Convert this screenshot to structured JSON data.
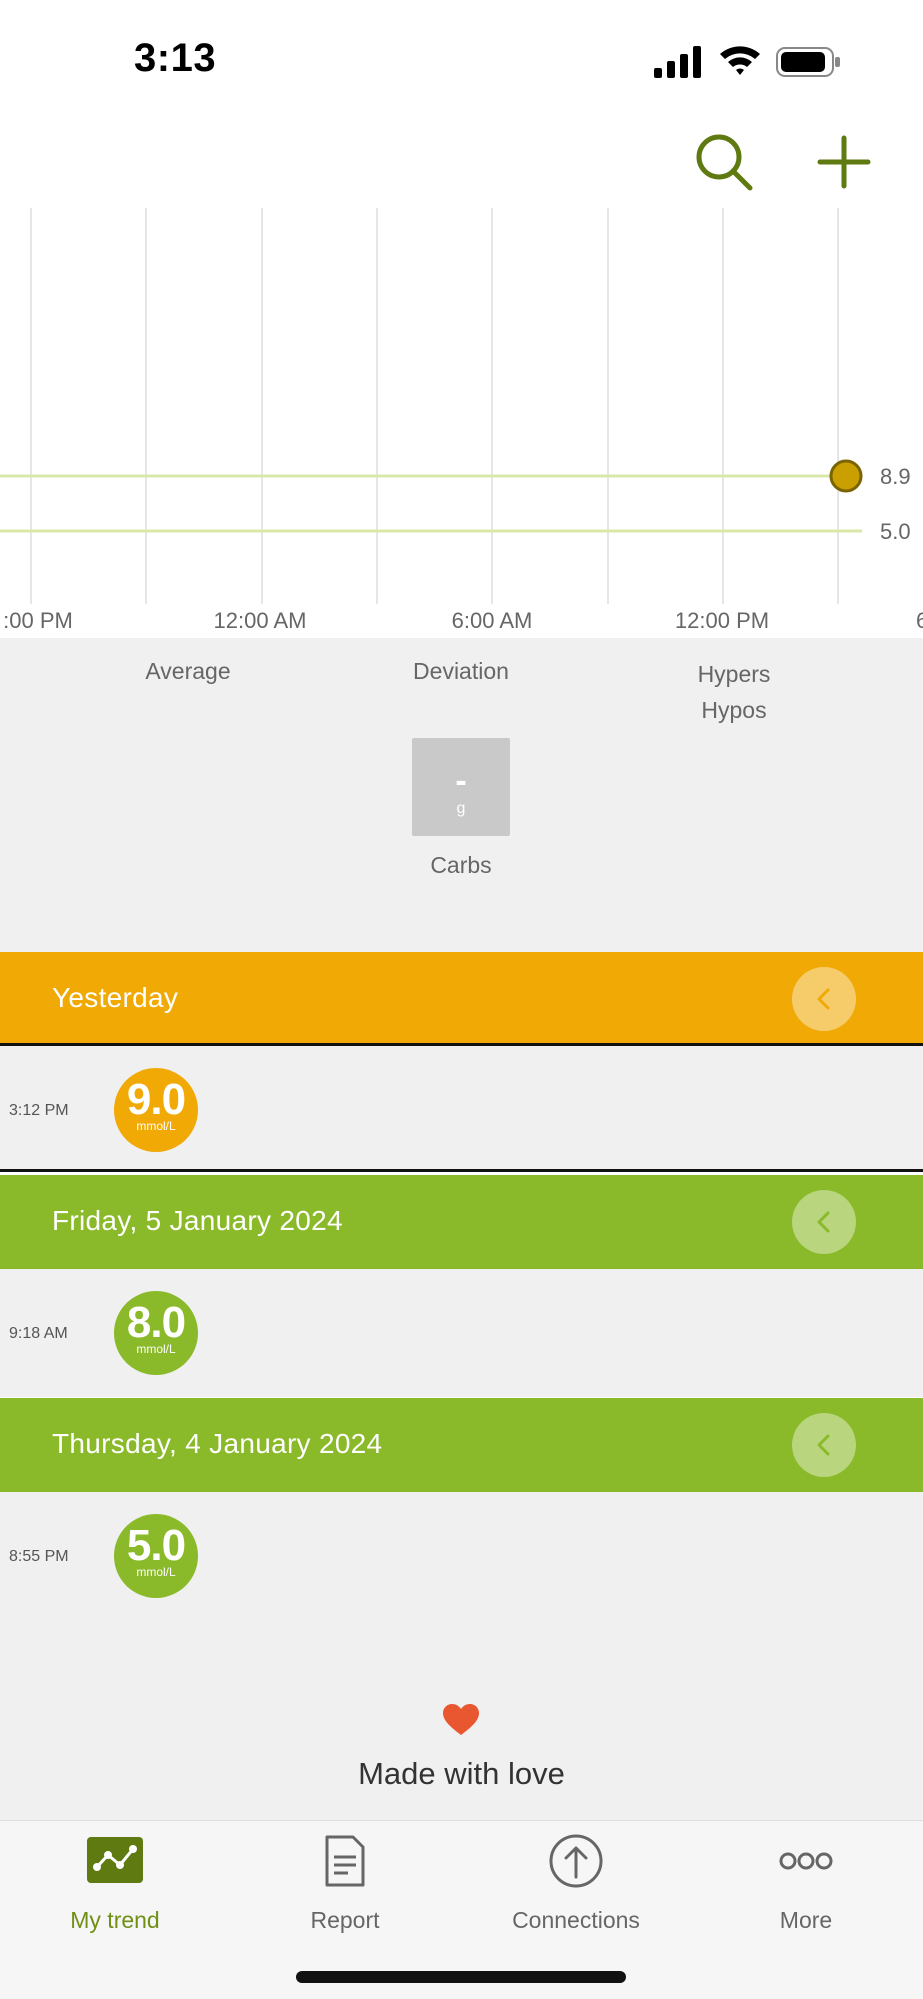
{
  "status_bar": {
    "time": "3:13"
  },
  "colors": {
    "accent_green": "#8ab929",
    "accent_orange": "#f0a905",
    "icon_green": "#5e7a10",
    "heart": "#e8572f"
  },
  "toolbar": {
    "search_icon": "search-icon",
    "add_icon": "plus-icon"
  },
  "chart_data": {
    "type": "line",
    "x_tick_labels": [
      ":00 PM",
      "12:00 AM",
      "6:00 AM",
      "12:00 PM",
      "6"
    ],
    "reference_lines": [
      8.9,
      5.0
    ],
    "reference_labels": [
      "8.9",
      "5.0"
    ],
    "points": [
      {
        "y": 8.9
      }
    ],
    "grid": true
  },
  "stats": {
    "average_label": "Average",
    "deviation_label": "Deviation",
    "hypers_label": "Hypers",
    "hypos_label": "Hypos",
    "carbs_value": "-",
    "carbs_unit": "g",
    "carbs_label": "Carbs"
  },
  "days": [
    {
      "title": "Yesterday",
      "time": "3:12 PM",
      "value": "9.0",
      "unit": "mmol/L"
    },
    {
      "title": "Friday, 5 January 2024",
      "time": "9:18 AM",
      "value": "8.0",
      "unit": "mmol/L"
    },
    {
      "title": "Thursday, 4 January 2024",
      "time": "8:55 PM",
      "value": "5.0",
      "unit": "mmol/L"
    }
  ],
  "footer": {
    "text": "Made with love"
  },
  "tabs": [
    {
      "label": "My trend",
      "icon": "trend-icon",
      "active": true
    },
    {
      "label": "Report",
      "icon": "report-icon",
      "active": false
    },
    {
      "label": "Connections",
      "icon": "upload-icon",
      "active": false
    },
    {
      "label": "More",
      "icon": "more-icon",
      "active": false
    }
  ]
}
